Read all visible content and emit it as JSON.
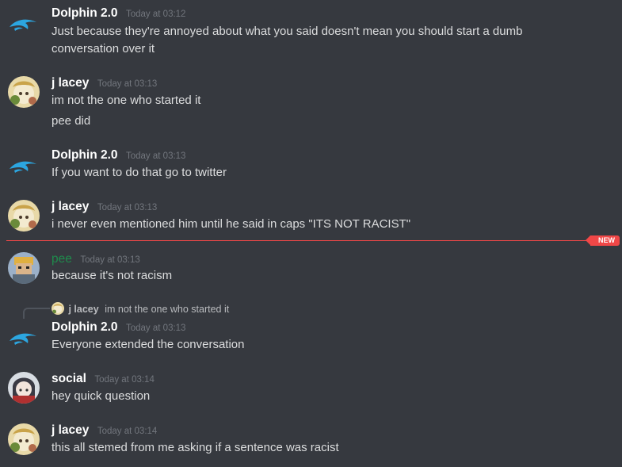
{
  "messages": [
    {
      "author": "Dolphin 2.0",
      "timestamp": "Today at 03:12",
      "lines": [
        "Just because they're annoyed about what you said doesn't mean you should start a dumb",
        "conversation over it"
      ]
    },
    {
      "author": "j lacey",
      "timestamp": "Today at 03:13",
      "lines": [
        "im not the one who started it",
        "pee did"
      ]
    },
    {
      "author": "Dolphin 2.0",
      "timestamp": "Today at 03:13",
      "lines": [
        "If you want to do that go to twitter"
      ]
    },
    {
      "author": "j lacey",
      "timestamp": "Today at 03:13",
      "lines": [
        "i never even mentioned him until he said in caps \"ITS NOT RACIST\""
      ]
    },
    {
      "author": "pee",
      "timestamp": "Today at 03:13",
      "lines": [
        "because it's not racism"
      ]
    },
    {
      "author": "Dolphin 2.0",
      "timestamp": "Today at 03:13",
      "lines": [
        "Everyone extended the conversation"
      ],
      "reply": {
        "author": "j lacey",
        "text": "im not the one who started it"
      }
    },
    {
      "author": "social",
      "timestamp": "Today at 03:14",
      "lines": [
        "hey quick question"
      ]
    },
    {
      "author": "j lacey",
      "timestamp": "Today at 03:14",
      "lines": [
        "this all stemed from me asking if a sentence was racist"
      ]
    }
  ],
  "new_divider": {
    "label": "NEW"
  },
  "colors": {
    "background": "#36393f",
    "new_marker": "#f04747",
    "pee_name": "#1f8b4c",
    "dolphin_blue": "#2ca6e0"
  }
}
